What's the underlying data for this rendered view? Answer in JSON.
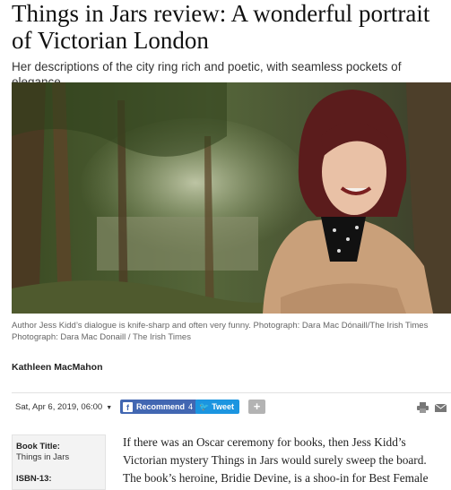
{
  "article": {
    "headline": "Things in Jars review: A wonderful portrait of Victorian London",
    "standfirst": "Her descriptions of the city ring rich and poetic, with seamless pockets of elegance",
    "caption_line1": "Author Jess Kidd’s dialogue is knife-sharp and often very funny. Photograph: Dara Mac Dónaill/The Irish Times",
    "caption_line2": "Photograph: Dara Mac Donaill / The Irish Times",
    "author": "Kathleen MacMahon",
    "date": "Sat, Apr 6, 2019, 06:00",
    "body": "If there was an Oscar ceremony for books, then Jess Kidd’s Victorian mystery Things in Jars would surely sweep the board. The book’s heroine, Bridie Devine, is a shoo-in for Best Female"
  },
  "share": {
    "facebook_label": "Recommend",
    "facebook_count": "4",
    "twitter_label": "Tweet",
    "more_label": "+"
  },
  "factbox": {
    "title_label": "Book Title:",
    "title_value": "Things in Jars",
    "isbn_label": "ISBN-13:"
  },
  "icons": {
    "facebook": "facebook-icon",
    "twitter": "twitter-icon",
    "print": "print-icon",
    "email": "email-icon",
    "caret": "caret-down-icon"
  },
  "colors": {
    "facebook": "#4267b2",
    "twitter": "#1b95e0",
    "more": "#b3b3b3"
  }
}
